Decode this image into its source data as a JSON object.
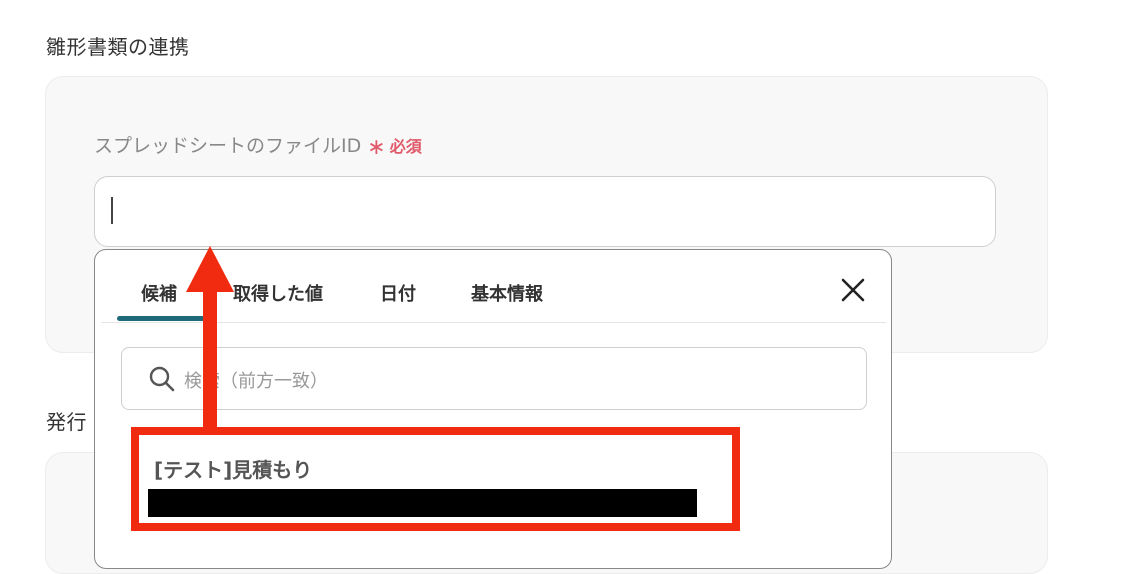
{
  "sections": {
    "template_link_title": "雛形書類の連携",
    "issue_title_partial": "発行"
  },
  "field": {
    "label": "スプレッドシートのファイルID",
    "required_mark": "∗",
    "required_text": "必須",
    "value": ""
  },
  "popup": {
    "tabs": [
      {
        "label": "候補",
        "active": true
      },
      {
        "label": "取得した値",
        "active": false
      },
      {
        "label": "日付",
        "active": false
      },
      {
        "label": "基本情報",
        "active": false
      }
    ],
    "close_icon": "close-icon",
    "search": {
      "icon": "search-icon",
      "placeholder": "検索（前方一致）",
      "value": ""
    },
    "candidates": [
      {
        "title": "[テスト]見積もり",
        "subtitle_redacted": true
      }
    ]
  },
  "annotation": {
    "highlight_color": "#f02b10",
    "arrow_color": "#f02b10"
  },
  "colors": {
    "required": "#e05a6a",
    "tab_active_underline": "#1e6a7a",
    "card_background": "#f8f8f8"
  }
}
